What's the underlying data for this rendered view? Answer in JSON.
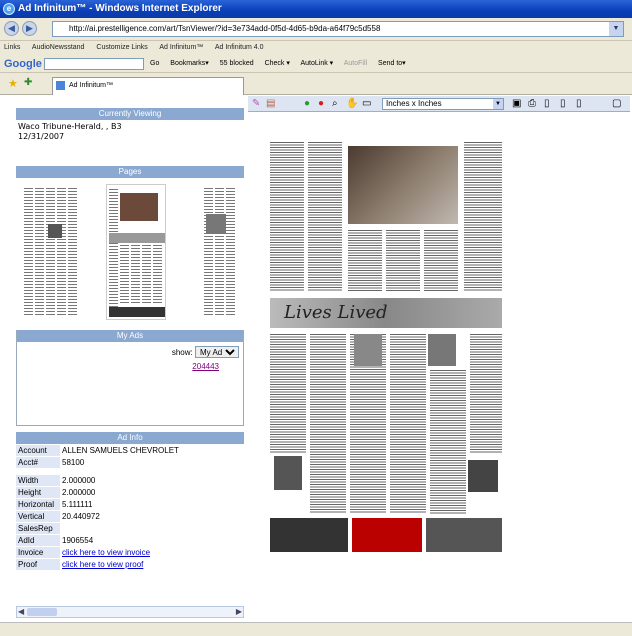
{
  "window": {
    "title": "Ad Infinitum™ - Windows Internet Explorer"
  },
  "address": {
    "url": "http://ai.prestelligence.com/art/TsnViewer/?id=3e734add-0f5d-4d65-b9da-a64f79c5d558"
  },
  "links_bar": {
    "label": "Links",
    "items": [
      "AudioNewsstand",
      "Customize Links",
      "Ad Infinitum™",
      "Ad Infinitum 4.0"
    ]
  },
  "google_bar": {
    "logo": "Google",
    "items": [
      "Go",
      "Bookmarks▾",
      "55 blocked",
      "Check ▾",
      "AutoLink ▾",
      "AutoFill",
      "Send to▾"
    ]
  },
  "tab": {
    "label": "Ad Infinitum™"
  },
  "currently_viewing": {
    "header": "Currently Viewing",
    "line1": "Waco Tribune-Herald, , B3",
    "line2": "12/31/2007"
  },
  "pages": {
    "header": "Pages"
  },
  "my_ads": {
    "header": "My Ads",
    "show_label": "show:",
    "select_value": "My Ads",
    "ad_link": "204443"
  },
  "ad_info": {
    "header": "Ad Info",
    "rows_top": [
      {
        "k": "Account",
        "v": "ALLEN SAMUELS CHEVROLET"
      },
      {
        "k": "Acct#",
        "v": "58100"
      }
    ],
    "rows_bottom": [
      {
        "k": "Width",
        "v": "2.000000"
      },
      {
        "k": "Height",
        "v": "2.000000"
      },
      {
        "k": "Horizontal",
        "v": "5.111111"
      },
      {
        "k": "Vertical",
        "v": "20.440972"
      },
      {
        "k": "SalesRep",
        "v": ""
      },
      {
        "k": "AdId",
        "v": "1906554"
      }
    ],
    "invoice": {
      "k": "Invoice",
      "link": "click here to view invoice"
    },
    "proof": {
      "k": "Proof",
      "link": "click here to view proof"
    }
  },
  "viewer": {
    "units_select": "Inches x Inches"
  },
  "newspaper": {
    "banner_text": "Lives Lived"
  }
}
